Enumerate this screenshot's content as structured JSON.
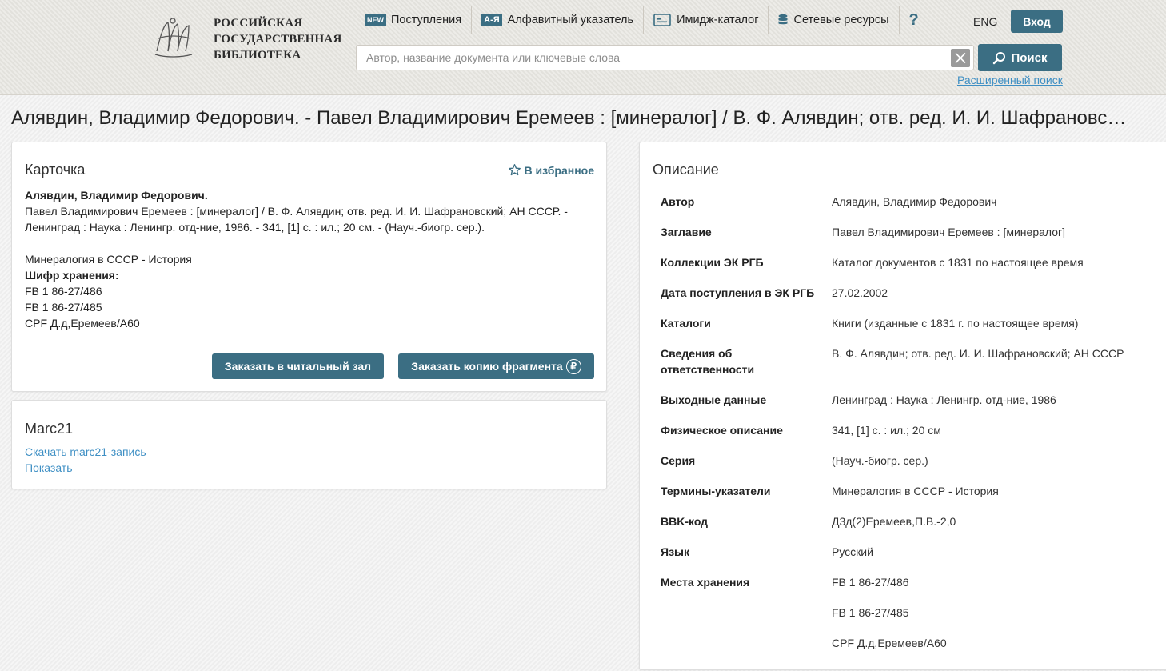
{
  "header": {
    "logo_lines": [
      "РОССИЙСКАЯ",
      "ГОСУДАРСТВЕННАЯ",
      "БИБЛИОТЕКА"
    ],
    "nav": [
      {
        "badge": "NEW",
        "label": "Поступления",
        "icon": "new-badge-icon"
      },
      {
        "badge": "А-Я",
        "label": "Алфавитный указатель",
        "icon": "az-badge-icon"
      },
      {
        "label": "Имидж-каталог",
        "icon": "card-catalog-icon"
      },
      {
        "label": "Сетевые ресурсы",
        "icon": "database-icon"
      }
    ],
    "help": "?",
    "lang": "ENG",
    "login": "Вход",
    "search_placeholder": "Автор, название документа или ключевые слова",
    "search_button": "Поиск",
    "advanced_search": "Расширенный поиск"
  },
  "doc_title": "Алявдин, Владимир Федорович. - Павел Владимирович Еремеев : [минералог] / В. Ф. Алявдин; отв. ред. И. И. Шафрановский; АН СССР. - Ленинград : Наука : Ленингр. отд-ние, 1986. - 341, [1] с. : ил.; 20 см. - (Науч.-биогр. сер.)",
  "card": {
    "title": "Карточка",
    "favorite": "В избранное",
    "author": "Алявдин, Владимир Федорович.",
    "description_lines": [
      "Павел Владимирович Еремеев : [минералог] / В. Ф. Алявдин; отв. ред. И. И. Шафрановский; АН СССР. -",
      "Ленинград : Наука : Ленингр. отд-ние, 1986. - 341, [1] с. : ил.; 20 см. - (Науч.-биогр. сер.)."
    ],
    "subject": "Минералогия в СССР - История",
    "storage_label": "Шифр хранения:",
    "storage": [
      "FB 1 86-27/486",
      "FB 1 86-27/485",
      "CPF Д.д,Еремеев/А60"
    ],
    "order_reading_room": "Заказать в читальный зал",
    "order_copy": "Заказать копию фрагмента",
    "ruble": "₽"
  },
  "marc": {
    "title": "Marc21",
    "download": "Скачать marc21-запись",
    "show": "Показать"
  },
  "description": {
    "title": "Описание",
    "rows": [
      {
        "k": "Автор",
        "v": "Алявдин, Владимир Федорович"
      },
      {
        "k": "Заглавие",
        "v": "Павел Владимирович Еремеев : [минералог]"
      },
      {
        "k": "Коллекции ЭК РГБ",
        "v": "Каталог документов с 1831 по настоящее время"
      },
      {
        "k": "Дата поступления в ЭК РГБ",
        "v": "27.02.2002"
      },
      {
        "k": "Каталоги",
        "v": "Книги (изданные с 1831 г. по настоящее время)"
      },
      {
        "k": "Сведения об ответственности",
        "v": "В. Ф. Алявдин; отв. ред. И. И. Шафрановский; АН СССР"
      },
      {
        "k": "Выходные данные",
        "v": "Ленинград : Наука : Ленингр. отд-ние, 1986"
      },
      {
        "k": "Физическое описание",
        "v": "341, [1] с. : ил.; 20 см"
      },
      {
        "k": "Серия",
        "v": "(Науч.-биогр. сер.)"
      },
      {
        "k": "Термины-указатели",
        "v": "Минералогия в СССР - История"
      },
      {
        "k": "BBK-код",
        "v": "Д3д(2)Еремеев,П.В.-2,0"
      },
      {
        "k": "Язык",
        "v": "Русский"
      },
      {
        "k": "Места хранения",
        "v": "FB 1 86-27/486"
      },
      {
        "k": "",
        "v": "FB 1 86-27/485"
      },
      {
        "k": "",
        "v": "CPF Д.д,Еремеев/А60"
      }
    ]
  }
}
